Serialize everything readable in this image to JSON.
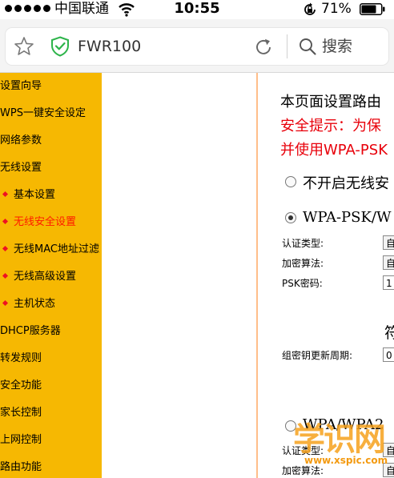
{
  "status_bar": {
    "carrier": "中国联通",
    "time": "10:55",
    "battery": "71%"
  },
  "browser": {
    "url_text": "FWR100",
    "search_label": "搜索"
  },
  "sidebar": {
    "items": [
      {
        "label": "设置向导",
        "sub": false,
        "active": false
      },
      {
        "label": "WPS一键安全设定",
        "sub": false,
        "active": false
      },
      {
        "label": "网络参数",
        "sub": false,
        "active": false
      },
      {
        "label": "无线设置",
        "sub": false,
        "active": false
      },
      {
        "label": "基本设置",
        "sub": true,
        "active": false
      },
      {
        "label": "无线安全设置",
        "sub": true,
        "active": true
      },
      {
        "label": "无线MAC地址过滤",
        "sub": true,
        "active": false
      },
      {
        "label": "无线高级设置",
        "sub": true,
        "active": false
      },
      {
        "label": "主机状态",
        "sub": true,
        "active": false
      },
      {
        "label": "DHCP服务器",
        "sub": false,
        "active": false
      },
      {
        "label": "转发规则",
        "sub": false,
        "active": false
      },
      {
        "label": "安全功能",
        "sub": false,
        "active": false
      },
      {
        "label": "家长控制",
        "sub": false,
        "active": false
      },
      {
        "label": "上网控制",
        "sub": false,
        "active": false
      },
      {
        "label": "路由功能",
        "sub": false,
        "active": false
      }
    ]
  },
  "content": {
    "intro": "本页面设置路由",
    "tip_line1": "安全提示：为保",
    "tip_line2": "并使用WPA-PSK",
    "option_none": "不开启无线安",
    "option_psk": "WPA-PSK/W",
    "auth_type_label": "认证类型:",
    "auth_type_value": "自",
    "encrypt_label": "加密算法:",
    "encrypt_value": "自",
    "psk_label": "PSK密码:",
    "psk_value": "1",
    "fu_char": "符",
    "group_key_label": "组密钥更新周期:",
    "group_key_value": "0",
    "option_wpa": "WPA/WPA2",
    "auth_type_label2": "认证类型:",
    "auth_type_value2": "自",
    "encrypt_label2": "加密算法:",
    "encrypt_value2": "自"
  },
  "watermark": {
    "text": "学识网",
    "url": "www.xspic.com"
  },
  "colors": {
    "sidebar_bg": "#f6b802",
    "active_item": "#ff1a00",
    "warning_text": "#e8000a",
    "shield_green": "#2db44a"
  }
}
